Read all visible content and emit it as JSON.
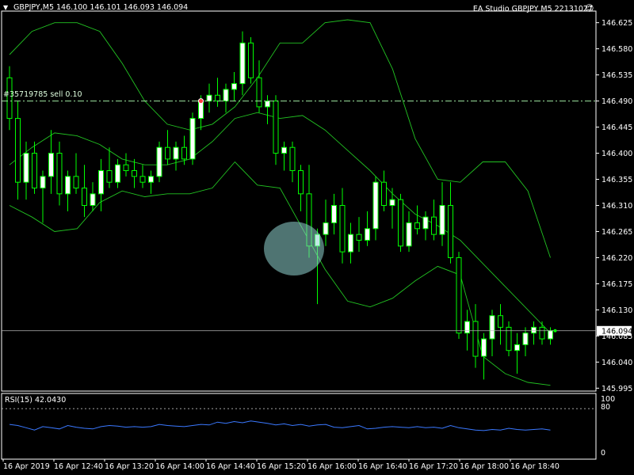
{
  "header": {
    "symbol_info": "GBPJPY,M5  146.100 146.101 146.093 146.094",
    "ea_label": "EA Studio GBPJPY M5 22131027"
  },
  "order_line": {
    "label": "#35719785 sell 0.10",
    "price": 146.49,
    "color": "#9fe6a0"
  },
  "current_price": {
    "label": "146.094",
    "value": 146.094
  },
  "rsi_panel": {
    "title": "RSI(15) 42.0430",
    "levels": [
      "100",
      "80",
      "0"
    ]
  },
  "colors": {
    "background": "#000000",
    "bull_candle": "#ffffff",
    "bear_candle": "#000000",
    "wick": "#00ff00",
    "bands": "#22c322",
    "rsi_line": "#3a78ff",
    "highlight": "#8fd4d0",
    "axis": "#ffffff"
  },
  "chart_data": {
    "type": "candlestick",
    "symbol": "GBPJPY",
    "timeframe": "M5",
    "y_ticks": [
      "146.625",
      "146.580",
      "146.535",
      "146.490",
      "146.445",
      "146.400",
      "146.355",
      "146.310",
      "146.265",
      "146.220",
      "146.175",
      "146.130",
      "146.085",
      "146.040",
      "145.995"
    ],
    "ylim": [
      145.99,
      146.645
    ],
    "x_ticks": [
      "16 Apr 2019",
      "16 Apr 12:40",
      "16 Apr 13:20",
      "16 Apr 14:00",
      "16 Apr 14:40",
      "16 Apr 15:20",
      "16 Apr 16:00",
      "16 Apr 16:40",
      "16 Apr 17:20",
      "16 Apr 18:00",
      "16 Apr 18:40"
    ],
    "candles": [
      [
        146.53,
        146.55,
        146.44,
        146.46
      ],
      [
        146.46,
        146.49,
        146.32,
        146.35
      ],
      [
        146.35,
        146.42,
        146.32,
        146.4
      ],
      [
        146.4,
        146.42,
        146.33,
        146.34
      ],
      [
        146.34,
        146.37,
        146.28,
        146.36
      ],
      [
        146.36,
        146.44,
        146.33,
        146.4
      ],
      [
        146.4,
        146.42,
        146.31,
        146.33
      ],
      [
        146.33,
        146.37,
        146.3,
        146.36
      ],
      [
        146.36,
        146.4,
        146.33,
        146.34
      ],
      [
        146.34,
        146.38,
        146.29,
        146.31
      ],
      [
        146.31,
        146.35,
        146.3,
        146.33
      ],
      [
        146.33,
        146.39,
        146.3,
        146.37
      ],
      [
        146.37,
        146.41,
        146.34,
        146.35
      ],
      [
        146.35,
        146.39,
        146.34,
        146.38
      ],
      [
        146.38,
        146.4,
        146.36,
        146.37
      ],
      [
        146.37,
        146.39,
        146.34,
        146.36
      ],
      [
        146.36,
        146.38,
        146.34,
        146.35
      ],
      [
        146.35,
        146.37,
        146.33,
        146.36
      ],
      [
        146.36,
        146.42,
        146.35,
        146.41
      ],
      [
        146.41,
        146.44,
        146.38,
        146.39
      ],
      [
        146.39,
        146.42,
        146.37,
        146.41
      ],
      [
        146.41,
        146.43,
        146.38,
        146.39
      ],
      [
        146.39,
        146.47,
        146.38,
        146.46
      ],
      [
        146.46,
        146.5,
        146.44,
        146.49
      ],
      [
        146.49,
        146.52,
        146.47,
        146.5
      ],
      [
        146.5,
        146.53,
        146.48,
        146.49
      ],
      [
        146.49,
        146.52,
        146.47,
        146.51
      ],
      [
        146.51,
        146.54,
        146.49,
        146.52
      ],
      [
        146.52,
        146.61,
        146.5,
        146.59
      ],
      [
        146.59,
        146.6,
        146.52,
        146.53
      ],
      [
        146.53,
        146.56,
        146.47,
        146.48
      ],
      [
        146.48,
        146.5,
        146.45,
        146.49
      ],
      [
        146.49,
        146.5,
        146.38,
        146.4
      ],
      [
        146.4,
        146.42,
        146.37,
        146.41
      ],
      [
        146.41,
        146.42,
        146.35,
        146.37
      ],
      [
        146.37,
        146.38,
        146.3,
        146.33
      ],
      [
        146.33,
        146.38,
        146.22,
        146.24
      ],
      [
        146.24,
        146.27,
        146.14,
        146.26
      ],
      [
        146.26,
        146.32,
        146.24,
        146.28
      ],
      [
        146.28,
        146.33,
        146.26,
        146.31
      ],
      [
        146.31,
        146.34,
        146.21,
        146.23
      ],
      [
        146.23,
        146.28,
        146.21,
        146.26
      ],
      [
        146.26,
        146.29,
        146.23,
        146.25
      ],
      [
        146.25,
        146.3,
        146.24,
        146.27
      ],
      [
        146.27,
        146.36,
        146.25,
        146.35
      ],
      [
        146.35,
        146.37,
        146.3,
        146.31
      ],
      [
        146.31,
        146.34,
        146.27,
        146.32
      ],
      [
        146.32,
        146.33,
        146.23,
        146.24
      ],
      [
        146.24,
        146.3,
        146.23,
        146.28
      ],
      [
        146.28,
        146.31,
        146.26,
        146.27
      ],
      [
        146.27,
        146.3,
        146.25,
        146.29
      ],
      [
        146.29,
        146.32,
        146.25,
        146.26
      ],
      [
        146.26,
        146.35,
        146.24,
        146.31
      ],
      [
        146.31,
        146.35,
        146.21,
        146.22
      ],
      [
        146.22,
        146.23,
        146.08,
        146.09
      ],
      [
        146.09,
        146.13,
        146.06,
        146.11
      ],
      [
        146.11,
        146.14,
        146.03,
        146.05
      ],
      [
        146.05,
        146.09,
        146.01,
        146.08
      ],
      [
        146.08,
        146.13,
        146.05,
        146.12
      ],
      [
        146.12,
        146.14,
        146.07,
        146.1
      ],
      [
        146.1,
        146.11,
        146.05,
        146.06
      ],
      [
        146.06,
        146.09,
        146.02,
        146.07
      ],
      [
        146.07,
        146.1,
        146.05,
        146.09
      ],
      [
        146.09,
        146.11,
        146.07,
        146.1
      ],
      [
        146.1,
        146.11,
        146.07,
        146.08
      ],
      [
        146.08,
        146.1,
        146.07,
        146.094
      ]
    ],
    "bollinger": {
      "upper": [
        146.57,
        146.61,
        146.625,
        146.625,
        146.61,
        146.555,
        146.49,
        146.45,
        146.44,
        146.45,
        146.48,
        146.53,
        146.59,
        146.59,
        146.625,
        146.63,
        146.625,
        146.545,
        146.425,
        146.355,
        146.35,
        146.385,
        146.385,
        146.335,
        146.22
      ],
      "middle": [
        146.38,
        146.41,
        146.435,
        146.43,
        146.415,
        146.39,
        146.38,
        146.38,
        146.39,
        146.42,
        146.46,
        146.47,
        146.46,
        146.465,
        146.44,
        146.405,
        146.37,
        146.33,
        146.295,
        146.275,
        146.25,
        146.21,
        146.17,
        146.13,
        146.09
      ],
      "lower": [
        146.31,
        146.29,
        146.265,
        146.27,
        146.315,
        146.335,
        146.325,
        146.33,
        146.33,
        146.34,
        146.385,
        146.345,
        146.34,
        146.27,
        146.2,
        146.145,
        146.135,
        146.15,
        146.18,
        146.205,
        146.19,
        146.05,
        146.02,
        146.005,
        146.0
      ]
    },
    "rsi": {
      "period": 15,
      "value": 42.043,
      "ylim": [
        0,
        100
      ],
      "levels": [
        80
      ],
      "values": [
        52,
        50,
        46,
        42,
        48,
        46,
        44,
        50,
        47,
        45,
        44,
        48,
        50,
        49,
        47,
        48,
        47,
        48,
        52,
        50,
        49,
        48,
        50,
        52,
        51,
        56,
        54,
        57,
        55,
        58,
        56,
        54,
        51,
        53,
        50,
        52,
        49,
        51,
        52,
        47,
        46,
        48,
        50,
        44,
        45,
        47,
        48,
        47,
        46,
        48,
        46,
        47,
        45,
        50,
        46,
        44,
        42,
        41,
        43,
        42,
        45,
        43,
        42,
        43,
        44,
        42
      ]
    }
  }
}
